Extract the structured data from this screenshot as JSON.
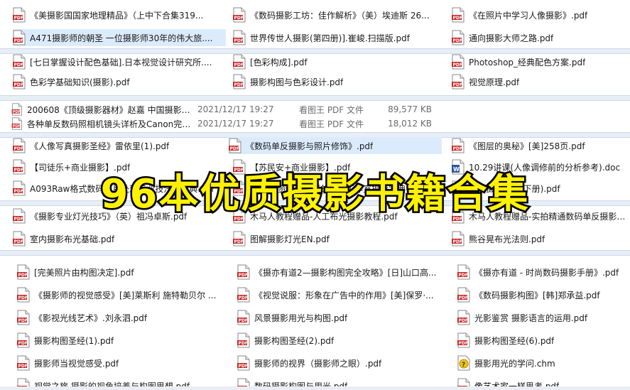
{
  "banner_title": "96本优质摄影书籍合集",
  "colors": {
    "pdf_red": "#c62828",
    "word_blue": "#2b579a",
    "selection": "#dcebfc",
    "banner_text": "#fff200"
  },
  "panel1": {
    "rows": [
      [
        "《美摄影国国家地理精品》（上中下合集319...",
        "《数码摄影工坊：佳作解析》（美）埃迪斯 26...",
        "《在照片中学习人像摄影》.pdf"
      ],
      [
        "A471摄影师的朝圣 一位摄影师30年的伟大旅....",
        "世界传世人摄影(第四册)].崔峻.扫描版.pdf",
        "通向摄影大师之路.pdf"
      ]
    ]
  },
  "panel2": {
    "rows": [
      [
        "[七日掌握设计配色基础].日本视觉设计研究所....",
        "[色彩构成].pdf",
        "Photoshop_经典配色方案.pdf"
      ],
      [
        "色彩学基础知识(摄影).pdf",
        "摄影构图与色彩设计.pdf",
        "视觉原理.pdf"
      ]
    ]
  },
  "panel3": {
    "rows": [
      {
        "name": "200608《顶级摄影器材》赵嘉 中国摄影....",
        "date": "2021/12/17 19:27",
        "type": "看图王 PDF 文件",
        "size": "89,577 KB"
      },
      {
        "name": "各种单反数码照相机镜头详析及Canon完....",
        "date": "2021/12/17 19:27",
        "type": "看图王 PDF 文件",
        "size": "18,012 KB"
      }
    ]
  },
  "panel4": {
    "rows": [
      [
        "《人像写真摄影圣经》雷依里(1).pdf",
        "《数码单反摄影与照片修饰》.pdf",
        "《图层的奥秘》[美]258页.pdf"
      ],
      [
        "【司徒乐+商业摄影】.pdf",
        "【苏民安+商业摄影】.pdf",
        "10.29讲课(人像调修前的分析参考).doc"
      ],
      [
        "A093Raw格式数码照片处理专业技法与宝典.pdf",
        "10余年资深摄影师的创意工作室摄影宝典.pdf",
        "高级摄影教材(下册).pdf"
      ]
    ]
  },
  "panel5": {
    "rows": [
      [
        "《摄影专业灯光技巧》（英）祖冯卓斯.pdf",
        "木马人教程赠品-人工布光摄影教程.pdf",
        "木马人教程赠品-实拍精通数码单反摄影曝光"
      ],
      [
        "室内摄影布光基础.pdf",
        "图解摄影灯光EN.pdf",
        "熊谷晃布光法则.pdf"
      ]
    ]
  },
  "panel6": {
    "rows": [
      [
        "[完美照片由构图决定].pdf",
        "《摄亦有道2—摄影构图完全攻略》[日]山口高...",
        "《摄亦有道 - 时尚数码摄影手册》.pdf"
      ],
      [
        "《摄影师的视觉感受》[美]莱斯利 施特勒贝尔 ...",
        "《视觉说服：形象在广告中的作用》[美]保罗·...",
        "《数码摄影构图》[韩]郑承益.pdf"
      ],
      [
        "《影视光线艺术》.刘永泗.pdf",
        "风景摄影用光与构图.pdf",
        "光影鉴赏 摄影语言的运用.pdf"
      ],
      [
        "摄影构图圣经(1).pdf",
        "摄影构图圣经(2).pdf",
        "摄影构图圣经(6).pdf"
      ],
      [
        "摄影师当视觉感受.pdf",
        "摄影师的视界（摄影师之眼）.pdf",
        "摄影用光的学问.chm"
      ],
      [
        "视觉之旅 摄影的视角培养与构图思想.pdf",
        "数码摄影构图与用光.pdf",
        "像艺术家一样思考.pdf"
      ]
    ]
  }
}
